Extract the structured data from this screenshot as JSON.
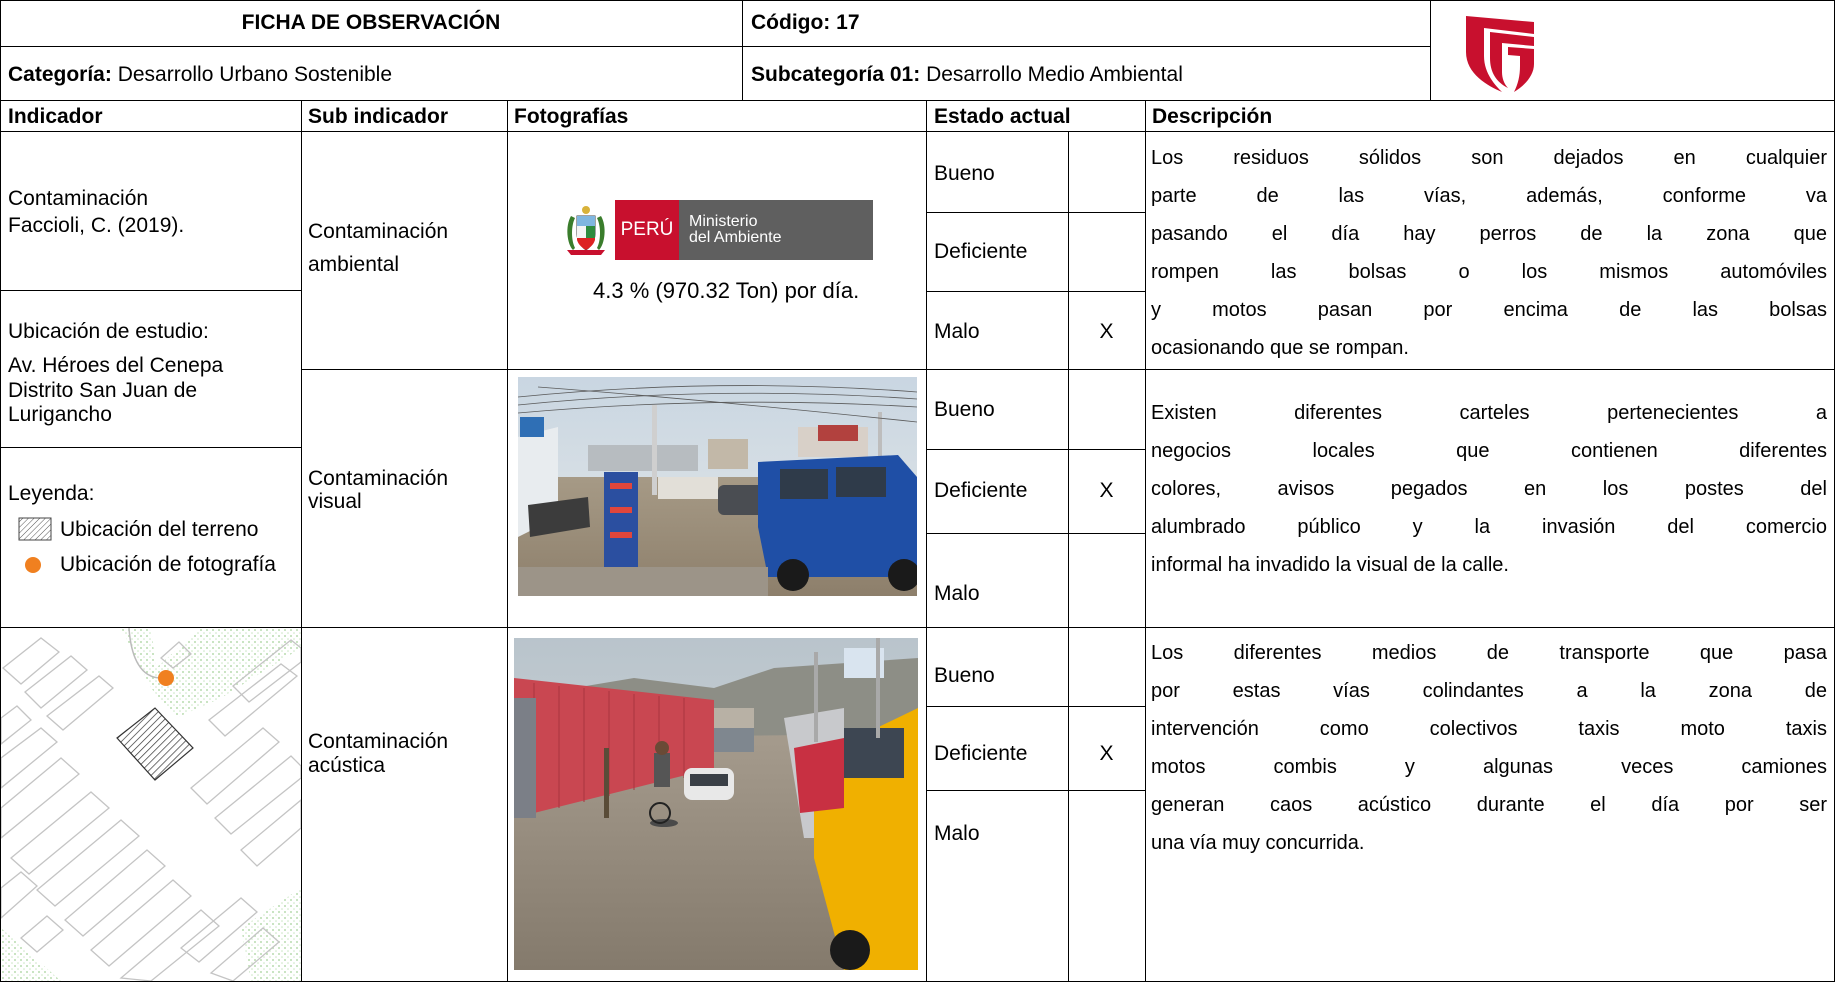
{
  "header": {
    "title": "FICHA DE OBSERVACIÓN",
    "code": "Código: 17",
    "category_label": "Categoría:",
    "category_value": " Desarrollo Urbano Sostenible",
    "subcategory_label": "Subcategoría 01:",
    "subcategory_value": " Desarrollo Medio Ambiental"
  },
  "columns": [
    "Indicador",
    "Sub indicador",
    "Fotografías",
    "Estado actual",
    "Descripción"
  ],
  "indicator": {
    "name": "Contaminación",
    "citation": "Faccioli, C. (2019).",
    "location_label": "Ubicación de estudio:",
    "location_lines": [
      "Av. Héroes del Cenepa",
      "Distrito San Juan de",
      "Lurigancho"
    ],
    "legend_label": "Leyenda:",
    "legend_items": [
      "Ubicación del terreno",
      "Ubicación de fotografía"
    ]
  },
  "logo": {
    "country": "PERÚ",
    "ministry_line1": "Ministerio",
    "ministry_line2": "del Ambiente"
  },
  "rows": [
    {
      "sub_indicator": [
        "Contaminación",
        "ambiental"
      ],
      "photo_caption": "4.3  % (970.32 Ton) por día.",
      "states": [
        {
          "label": "Bueno",
          "mark": ""
        },
        {
          "label": "Deficiente",
          "mark": ""
        },
        {
          "label": "Malo",
          "mark": "X"
        }
      ],
      "description": [
        "Los residuos sólidos son dejados en cualquier",
        "parte de las vías, además, conforme va",
        "pasando el día hay perros de la zona que",
        "rompen las bolsas o los mismos automóviles",
        "y motos pasan por encima de las bolsas",
        "ocasionando que se rompan."
      ]
    },
    {
      "sub_indicator": [
        "Contaminación",
        "visual"
      ],
      "states": [
        {
          "label": "Bueno",
          "mark": ""
        },
        {
          "label": "Deficiente",
          "mark": "X"
        },
        {
          "label": "Malo",
          "mark": ""
        }
      ],
      "description": [
        "Existen diferentes carteles pertenecientes a",
        "negocios locales que contienen diferentes",
        "colores, avisos pegados en los postes del",
        "alumbrado público y la invasión del comercio",
        "informal ha invadido la visual de la calle."
      ]
    },
    {
      "sub_indicator": [
        "Contaminación",
        "acústica"
      ],
      "states": [
        {
          "label": "Bueno",
          "mark": ""
        },
        {
          "label": "Deficiente",
          "mark": "X"
        },
        {
          "label": "Malo",
          "mark": ""
        }
      ],
      "description": [
        "Los diferentes medios de transporte que pasa",
        "por estas vías colindantes a la zona de",
        "intervención como colectivos taxis moto taxis",
        "motos combis y algunas veces camiones",
        "generan caos acústico durante el día por ser",
        "una vía muy concurrida."
      ]
    }
  ],
  "colors": {
    "logo_red": "#c8102e",
    "ministry_grey": "#5f5f5f",
    "legend_orange": "#f08020",
    "map_green": "#d7ecd2"
  }
}
